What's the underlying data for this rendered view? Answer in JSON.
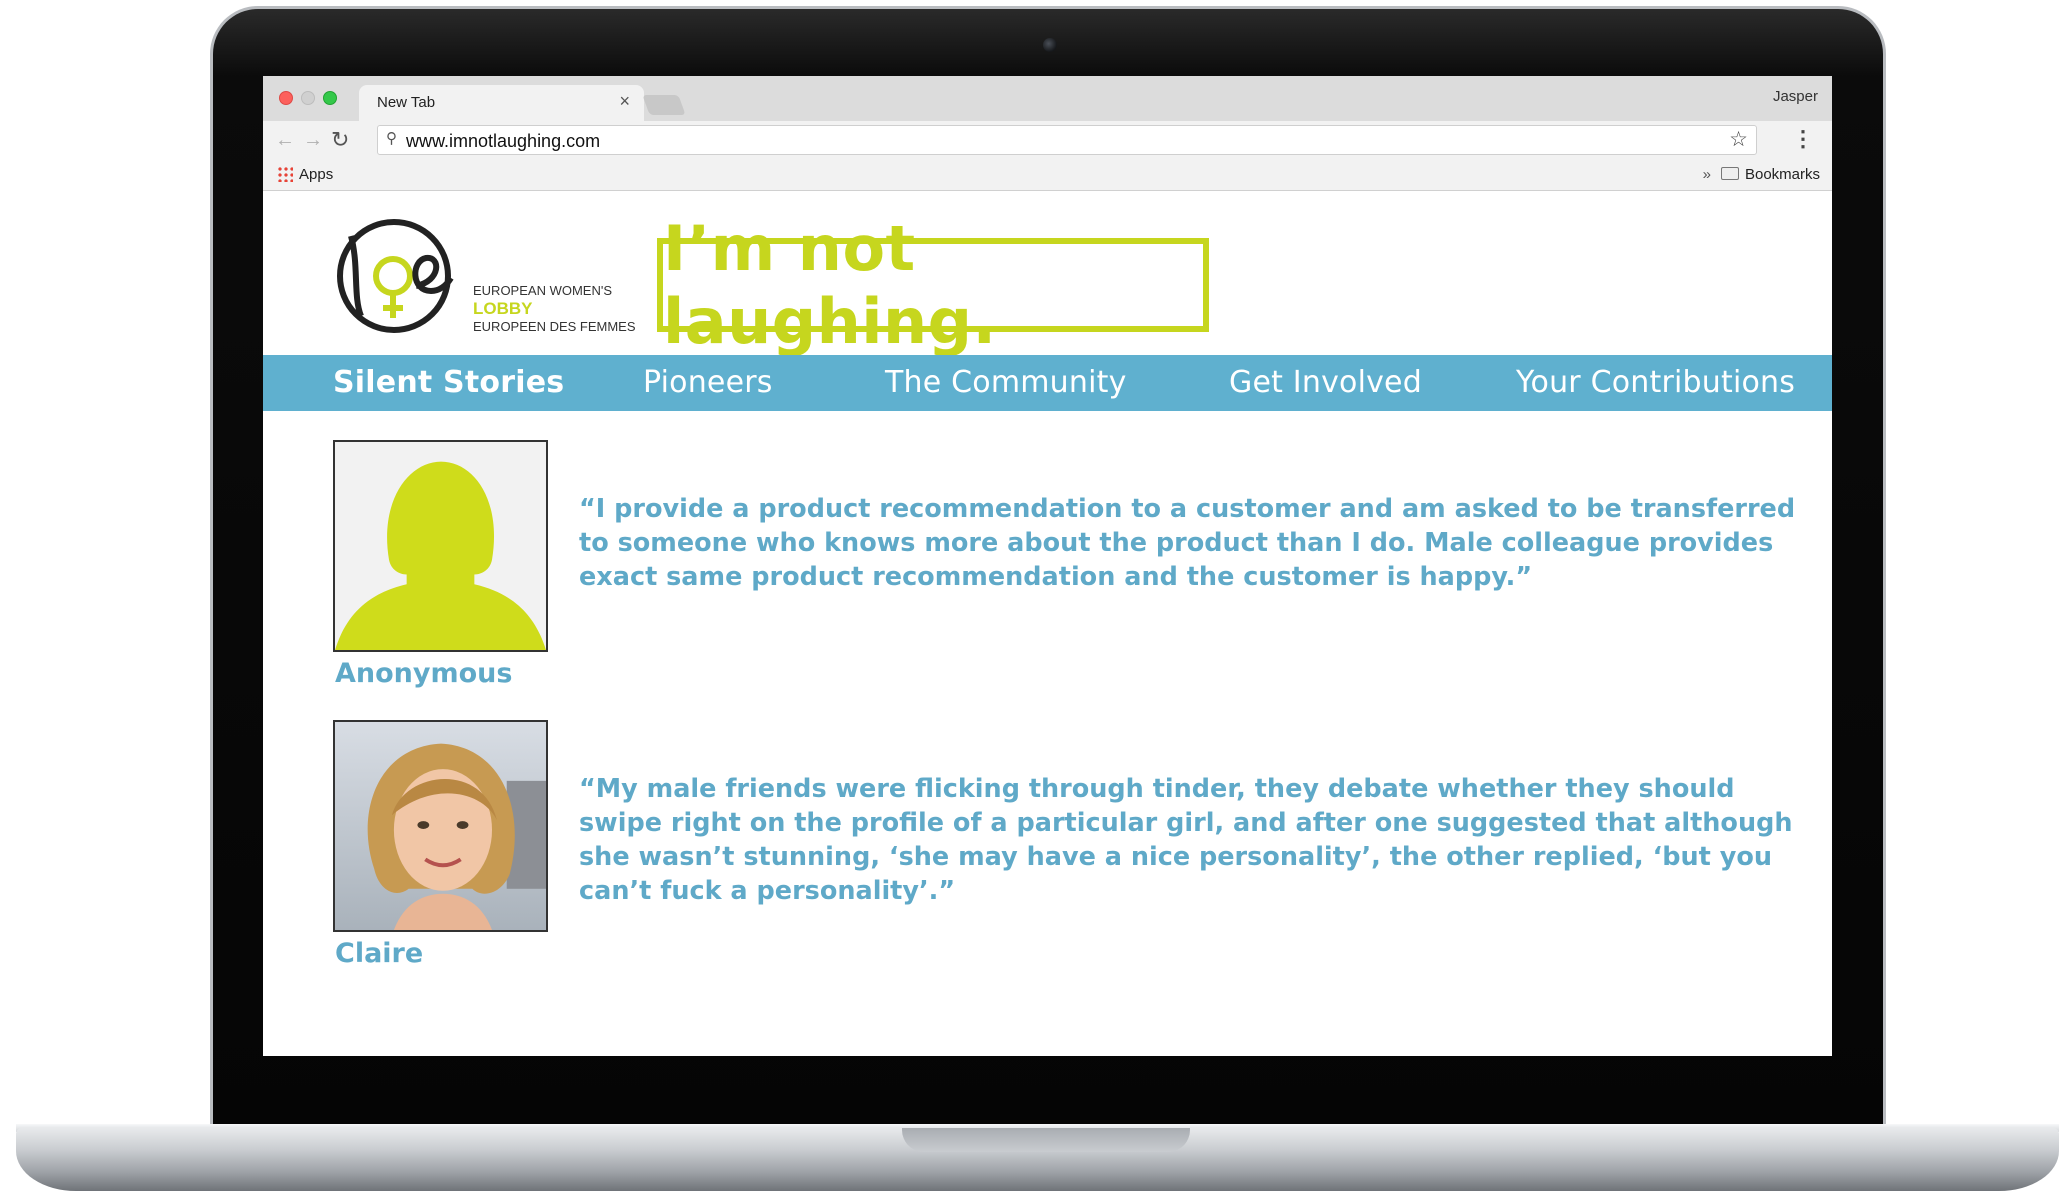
{
  "browser": {
    "tab_title": "New Tab",
    "tab_close": "×",
    "profile": "Jasper",
    "url": "www.imnotlaughing.com",
    "apps_label": "Apps",
    "bookmarks_arrows": "»",
    "bookmarks_label": "Bookmarks"
  },
  "header": {
    "org_line1": "EUROPEAN WOMEN'S",
    "org_line2": "LOBBY",
    "org_line3": "EUROPEEN DES FEMMES",
    "banner": "I’m not laughing."
  },
  "nav": {
    "items": [
      {
        "label": "Silent Stories",
        "active": true
      },
      {
        "label": "Pioneers"
      },
      {
        "label": "The Community"
      },
      {
        "label": "Get Involved"
      },
      {
        "label": "Your Contributions"
      }
    ]
  },
  "stories": [
    {
      "name": "Anonymous",
      "quote": "“I provide a product recommendation to a customer and am asked to be transferred to someone who knows more about the product than I do. Male colleague provides exact same product recommendation and the customer is happy.”"
    },
    {
      "name": "Claire",
      "quote": "“My male friends were flicking through tinder, they debate whether they should swipe right on the profile of a particular girl, and after one suggested that although she wasn’t stunning, ‘she may have a nice personality’, the other replied, ‘but you can’t fuck a personality’.”"
    }
  ],
  "colors": {
    "brand_green": "#c6d61e",
    "nav_blue": "#5fb0cf",
    "quote_blue": "#5fa9c8"
  }
}
